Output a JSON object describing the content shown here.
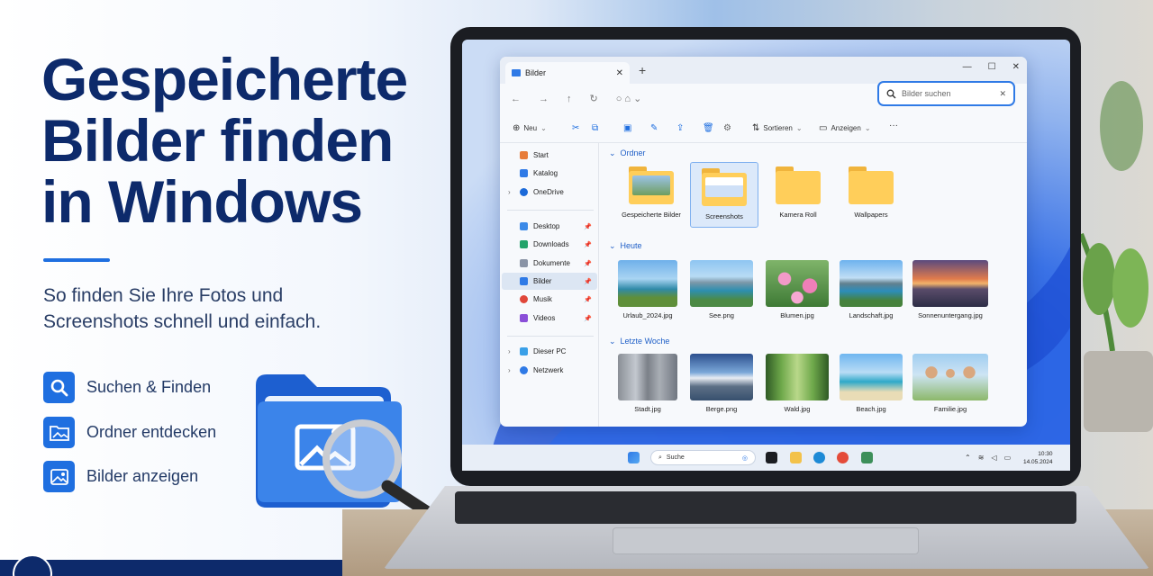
{
  "hero": {
    "title": "Gespeicherte\nBilder finden\nin Windows",
    "subtitle": "So finden Sie Ihre Fotos und\nScreenshots schnell und einfach.",
    "features": [
      {
        "label": "Suchen & Finden",
        "icon": "search-icon"
      },
      {
        "label": "Ordner entdecken",
        "icon": "folder-image-icon"
      },
      {
        "label": "Bilder anzeigen",
        "icon": "image-icon"
      }
    ],
    "accent": "#1f6fe0",
    "title_color": "#0d2a6b"
  },
  "explorer": {
    "tab_title": "Bilder",
    "search_placeholder": "Bilder suchen",
    "toolbar": {
      "new_label": "Neu",
      "sort_label": "Sortieren",
      "view_label": "Anzeigen",
      "more_label": "···"
    },
    "sidebar": {
      "items": [
        {
          "label": "Start",
          "icon": "home-icon"
        },
        {
          "label": "Katalog",
          "icon": "gallery-icon"
        },
        {
          "label": "OneDrive",
          "icon": "cloud-icon"
        },
        {
          "label": "Desktop",
          "icon": "desktop-icon"
        },
        {
          "label": "Downloads",
          "icon": "download-icon"
        },
        {
          "label": "Dokumente",
          "icon": "document-icon"
        },
        {
          "label": "Bilder",
          "icon": "pictures-icon"
        },
        {
          "label": "Musik",
          "icon": "music-icon"
        },
        {
          "label": "Videos",
          "icon": "video-icon"
        },
        {
          "label": "Dieser PC",
          "icon": "pc-icon"
        },
        {
          "label": "Netzwerk",
          "icon": "network-icon"
        }
      ]
    },
    "sections": {
      "folders_heading": "Ordner",
      "today_heading": "Heute",
      "last_week_heading": "Letzte Woche"
    },
    "folders": [
      {
        "name": "Gespeicherte Bilder"
      },
      {
        "name": "Screenshots"
      },
      {
        "name": "Kamera Roll"
      },
      {
        "name": "Wallpapers"
      }
    ],
    "today_files": [
      {
        "name": "Urlaub_2024.jpg"
      },
      {
        "name": "See.png"
      },
      {
        "name": "Blumen.jpg"
      },
      {
        "name": "Landschaft.jpg"
      },
      {
        "name": "Sonnenuntergang.jpg"
      }
    ],
    "last_week_files": [
      {
        "name": "Stadt.jpg"
      },
      {
        "name": "Berge.png"
      },
      {
        "name": "Wald.jpg"
      },
      {
        "name": "Beach.jpg"
      },
      {
        "name": "Familie.jpg"
      }
    ]
  },
  "taskbar": {
    "search_label": "Suche",
    "time": "10:30",
    "date": "14.05.2024"
  }
}
